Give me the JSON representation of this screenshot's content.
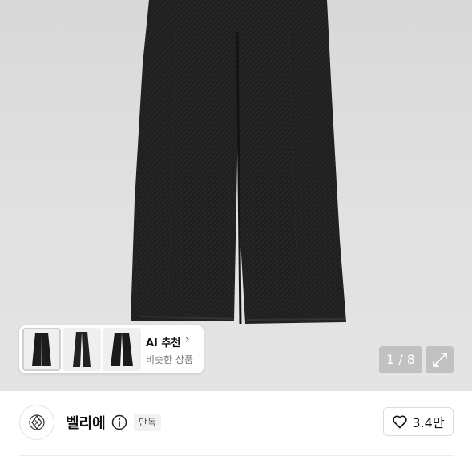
{
  "gallery": {
    "counter": "1 / 8",
    "expand_icon": "expand-icon",
    "reco": {
      "title": "AI 추천",
      "subtitle": "비슷한 상품",
      "chevron": "›"
    }
  },
  "store": {
    "name": "벨리에",
    "badge": "단독",
    "info_icon": "info-icon",
    "likes": "3.4만",
    "like_icon": "heart-icon"
  },
  "colors": {
    "denim": "#1e1e1e",
    "background": "#e0e0e0",
    "accent_text": "#111111"
  }
}
